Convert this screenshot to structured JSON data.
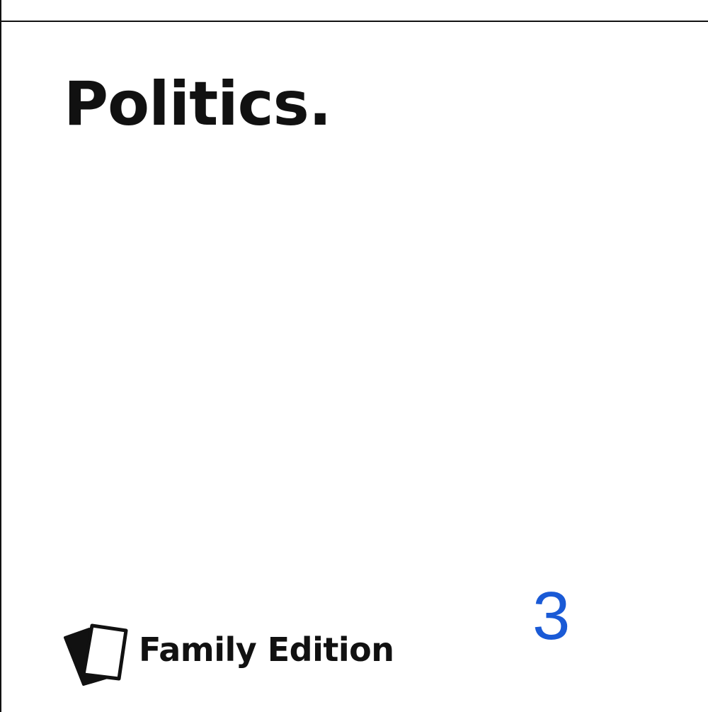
{
  "card": {
    "title": "Politics.",
    "number": "3",
    "brand_label": "Family Edition"
  },
  "icons": {
    "brand": "cards-icon"
  },
  "colors": {
    "text": "#111111",
    "number": "#1a5ad6",
    "background": "#ffffff"
  }
}
